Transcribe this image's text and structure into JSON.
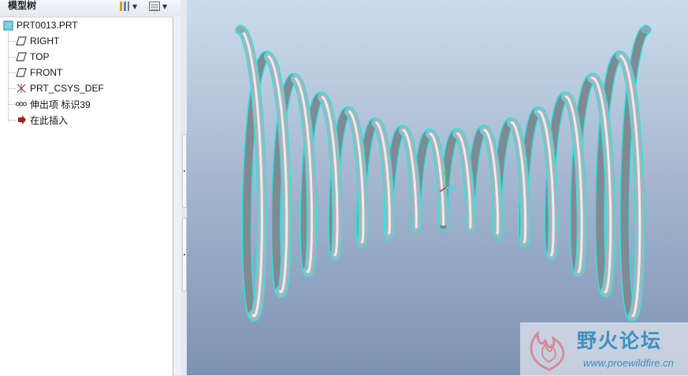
{
  "panel": {
    "title": "模型树",
    "toolbar": {
      "show_icon": "tree-filter-icon",
      "settings_icon": "tree-columns-icon"
    }
  },
  "tree": {
    "items": [
      {
        "label": "PRT0013.PRT",
        "icon": "part-icon"
      },
      {
        "label": "RIGHT",
        "icon": "datum-plane-icon"
      },
      {
        "label": "TOP",
        "icon": "datum-plane-icon"
      },
      {
        "label": "FRONT",
        "icon": "datum-plane-icon"
      },
      {
        "label": "PRT_CSYS_DEF",
        "icon": "coordinate-system-icon"
      },
      {
        "label": "伸出项 标识39",
        "icon": "protrusion-icon"
      },
      {
        "label": "在此插入",
        "icon": "insert-here-arrow-icon"
      }
    ]
  },
  "viewport": {
    "model": "helical-spring",
    "colors": {
      "background_top": "#ccdcec",
      "background_bottom": "#7e93b3",
      "edge_highlight": "#35e0e0",
      "surface": "#a9b3b9"
    }
  },
  "watermark": {
    "title": "野火论坛",
    "url": "www.proewildfire.cn"
  }
}
